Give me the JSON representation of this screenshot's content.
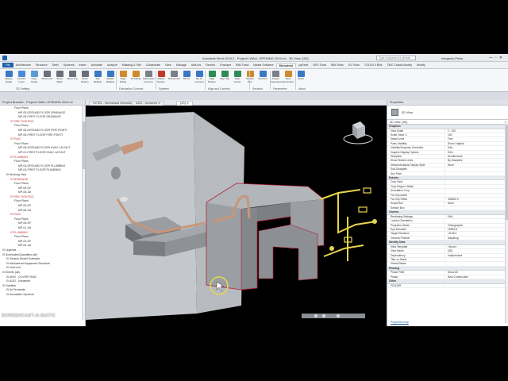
{
  "titlebar": {
    "app_title": "Autodesk Revit 2019.2 - Project1 WALL OPENING 2019.rvt - 3D View: {3D}",
    "search_placeholder": "Type a keyword or phrase",
    "user": "Integenic.Pelsk..."
  },
  "ribbon_tabs": [
    "File",
    "Architecture",
    "Structure",
    "Steel",
    "Systems",
    "Insert",
    "Annotate",
    "Analyze",
    "Massing & Site",
    "Collaborate",
    "View",
    "Manage",
    "Add-Ins",
    "Revizto",
    "Enscape",
    "BIM Track",
    "Ideate Software",
    "Microdesk",
    "pyRevit",
    "DEV Tools",
    "BIM Tools",
    "SV Tools",
    "TOOLS 4 BIM",
    "TMC Cicada Modify",
    "Modify"
  ],
  "active_tab": "Microdesk",
  "ribbon": {
    "buttons": [
      {
        "label": "Deploy Detail",
        "icon": "deploy-icon",
        "color": "#3b78c4"
      },
      {
        "label": "Convert Lines",
        "icon": "convert-lines-icon",
        "color": "#4a8bd6"
      },
      {
        "label": "Copy Detail",
        "icon": "copy-icon",
        "color": "#5e9ad8"
      },
      {
        "label": "Show Left",
        "icon": "show-left-icon",
        "color": "#6a6f78"
      },
      {
        "label": "Show Right",
        "icon": "show-right-icon",
        "color": "#6a6f78"
      },
      {
        "label": "Show Top",
        "icon": "show-top-icon",
        "color": "#6a6f78"
      },
      {
        "label": "Show Bottom",
        "icon": "show-bottom-icon",
        "color": "#6a6f78"
      },
      {
        "label": "Flip Multiple",
        "icon": "flip-icon",
        "color": "#3b78c4"
      },
      {
        "label": "Rotate Multiple",
        "icon": "rotate-icon",
        "color": "#3b78c4"
      },
      {
        "label": "Align Fitting",
        "icon": "align-fitting-icon",
        "color": "#d08a2c"
      },
      {
        "label": "Fit Fitting",
        "icon": "fit-icon",
        "color": "#d08a2c"
      },
      {
        "label": "Fabrication Connect",
        "icon": "fab-connect-icon",
        "color": "#7a7f88"
      },
      {
        "label": "Delete System",
        "icon": "delete-system-icon",
        "color": "#c0392b"
      },
      {
        "label": "Disconnect",
        "icon": "disconnect-icon",
        "color": "#7a7f88"
      },
      {
        "label": "Me To",
        "icon": "me-to-icon",
        "color": "#3b78c4"
      },
      {
        "label": "Me To Connect",
        "icon": "me-to-connect-icon",
        "color": "#3b78c4"
      },
      {
        "label": "Align Bottom",
        "icon": "align-bottom-icon",
        "color": "#2e8b57"
      },
      {
        "label": "Align Top",
        "icon": "align-top-icon",
        "color": "#2e8b57"
      },
      {
        "label": "Align Center",
        "icon": "align-center-icon",
        "color": "#2e8b57"
      },
      {
        "label": "Section Box",
        "icon": "section-box-icon",
        "color": "#d08a2c"
      },
      {
        "label": "Sections",
        "icon": "sections-icon",
        "color": "#3b78c4"
      },
      {
        "label": "Assign Parameters",
        "icon": "parameters-icon",
        "color": "#7a7f88"
      },
      {
        "label": "New Renumber",
        "icon": "renumber-icon",
        "color": "#d08a2c"
      },
      {
        "label": "About",
        "icon": "about-icon",
        "color": "#3b78c4"
      }
    ],
    "panels": [
      "3D Drafting",
      "Fabrication Connect",
      "Systems",
      "Align and Connect",
      "Sections",
      "Parameters",
      "About"
    ]
  },
  "browser": {
    "title": "Project Browser - Project1 WALL OPENING 2019.rvt",
    "items": [
      {
        "text": "Floor Plans",
        "indent": 3
      },
      {
        "text": "MP-05-GROUND FLOOR DRAINAGE",
        "indent": 4
      },
      {
        "text": "MP-05-FIRST FLOOR DRAINAGE",
        "indent": 4
      },
      {
        "text": "FIRE FIGHTING",
        "indent": 2,
        "red": true
      },
      {
        "text": "Floor Plans",
        "indent": 3
      },
      {
        "text": "MP-06-GROUND FLOOR FIRE FIGHTI",
        "indent": 4
      },
      {
        "text": "MP-06-FIRST FLOOR FIRE FIGHTI",
        "indent": 4
      },
      {
        "text": "HVAC",
        "indent": 2,
        "red": true
      },
      {
        "text": "Floor Plans",
        "indent": 3
      },
      {
        "text": "MP-08-GROUND FLOOR HVAC LAYOUT",
        "indent": 4
      },
      {
        "text": "MP-01-FIRST FLOOR HVAC LAYOUT",
        "indent": 4
      },
      {
        "text": "PLUMBING",
        "indent": 2,
        "red": true
      },
      {
        "text": "Floor Plans",
        "indent": 3
      },
      {
        "text": "MP-04-GROUND FLOOR PLUMBING",
        "indent": 4
      },
      {
        "text": "MP-04-FIRST FLOOR PLUMBING",
        "indent": 4
      },
      {
        "text": "Working View",
        "indent": 1
      },
      {
        "text": "DRAINAGE",
        "indent": 2,
        "red": true
      },
      {
        "text": "Floor Plans",
        "indent": 3
      },
      {
        "text": "MP-05-GF",
        "indent": 4
      },
      {
        "text": "MP-05-1st",
        "indent": 4
      },
      {
        "text": "FIRE FIGHTING",
        "indent": 2,
        "red": true
      },
      {
        "text": "Floor Plans",
        "indent": 3
      },
      {
        "text": "MP-06-GF",
        "indent": 4
      },
      {
        "text": "MP-06-1st",
        "indent": 4
      },
      {
        "text": "HVAC",
        "indent": 2,
        "red": true
      },
      {
        "text": "Floor Plans",
        "indent": 3
      },
      {
        "text": "MP-08-GF",
        "indent": 4
      },
      {
        "text": "MP-01-1st",
        "indent": 4
      },
      {
        "text": "PLUMBING",
        "indent": 2,
        "red": true
      },
      {
        "text": "Floor Plans",
        "indent": 3
      },
      {
        "text": "MP-04-GF",
        "indent": 4
      },
      {
        "text": "MP-04-1st",
        "indent": 4
      },
      {
        "text": "Legends",
        "indent": 0
      },
      {
        "text": "Schedules/Quantities (all)",
        "indent": 0
      },
      {
        "text": "Generic Model Schedule",
        "indent": 1
      },
      {
        "text": "Mechanical Equipment Schedule",
        "indent": 1
      },
      {
        "text": "View List",
        "indent": 1
      },
      {
        "text": "Sheets (all)",
        "indent": 0
      },
      {
        "text": "A000 - COVER PAGE",
        "indent": 1
      },
      {
        "text": "A102 - Unnamed",
        "indent": 1
      },
      {
        "text": "Families",
        "indent": 0
      },
      {
        "text": "Air Terminals",
        "indent": 1
      },
      {
        "text": "Annotation Symbols",
        "indent": 1
      }
    ]
  },
  "view_tabs": [
    {
      "label": "HCTB1 - Mechanical Schedule",
      "active": false
    },
    {
      "label": "A102 - Unnamed",
      "active": false
    },
    {
      "label": "{3D}",
      "active": true
    }
  ],
  "properties": {
    "title": "Properties",
    "type_name": "3D View",
    "selector": "3D View: {3D}",
    "edit_type": "Edit Type",
    "groups": [
      {
        "name": "Graphics",
        "rows": [
          [
            "View Scale",
            "1 : 100"
          ],
          [
            "Scale Value 1:",
            "100"
          ],
          [
            "Detail Level",
            "Fine"
          ],
          [
            "Parts Visibility",
            "Show Original"
          ],
          [
            "Visibility/Graphics Overrides",
            "Edit..."
          ],
          [
            "Graphic Display Options",
            "Edit..."
          ],
          [
            "Discipline",
            "Architectural"
          ],
          [
            "Show Hidden Lines",
            "By Discipline"
          ],
          [
            "Default Analysis Display Style",
            "None"
          ],
          [
            "Sub-Discipline",
            ""
          ],
          [
            "Sun Path",
            ""
          ]
        ]
      },
      {
        "name": "Extents",
        "rows": [
          [
            "Crop View",
            ""
          ],
          [
            "Crop Region Visible",
            ""
          ],
          [
            "Annotation Crop",
            ""
          ],
          [
            "Far Clip Active",
            ""
          ],
          [
            "Far Clip Offset",
            "304800.0"
          ],
          [
            "Scope Box",
            "None"
          ],
          [
            "Section Box",
            ""
          ]
        ]
      },
      {
        "name": "Camera",
        "rows": [
          [
            "Rendering Settings",
            "Edit..."
          ],
          [
            "Locked Orientation",
            ""
          ],
          [
            "Projection Mode",
            "Orthographic"
          ],
          [
            "Eye Elevation",
            "15983.8"
          ],
          [
            "Target Elevation",
            "-3136.2"
          ],
          [
            "Camera Position",
            "Adjusting"
          ]
        ]
      },
      {
        "name": "Identity Data",
        "rows": [
          [
            "View Template",
            "<None>"
          ],
          [
            "View Name",
            "{3D}"
          ],
          [
            "Dependency",
            "Independent"
          ],
          [
            "Title on Sheet",
            ""
          ],
          [
            "Views/Sheets",
            ""
          ]
        ]
      },
      {
        "name": "Phasing",
        "rows": [
          [
            "Phase Filter",
            "Show All"
          ],
          [
            "Phase",
            "New Construction"
          ]
        ]
      },
      {
        "name": "Other",
        "rows": [
          [
            "FOLDER",
            ""
          ]
        ]
      }
    ],
    "help_link": "Properties help"
  },
  "watermark": "SCREENCAST-O-MATIC",
  "colors": {
    "accent": "#1f5fa8",
    "duct": "#8f9296",
    "pipe_yellow": "#e6d44a",
    "pipe_copper": "#c8967a",
    "edge_red": "#b3203a"
  }
}
